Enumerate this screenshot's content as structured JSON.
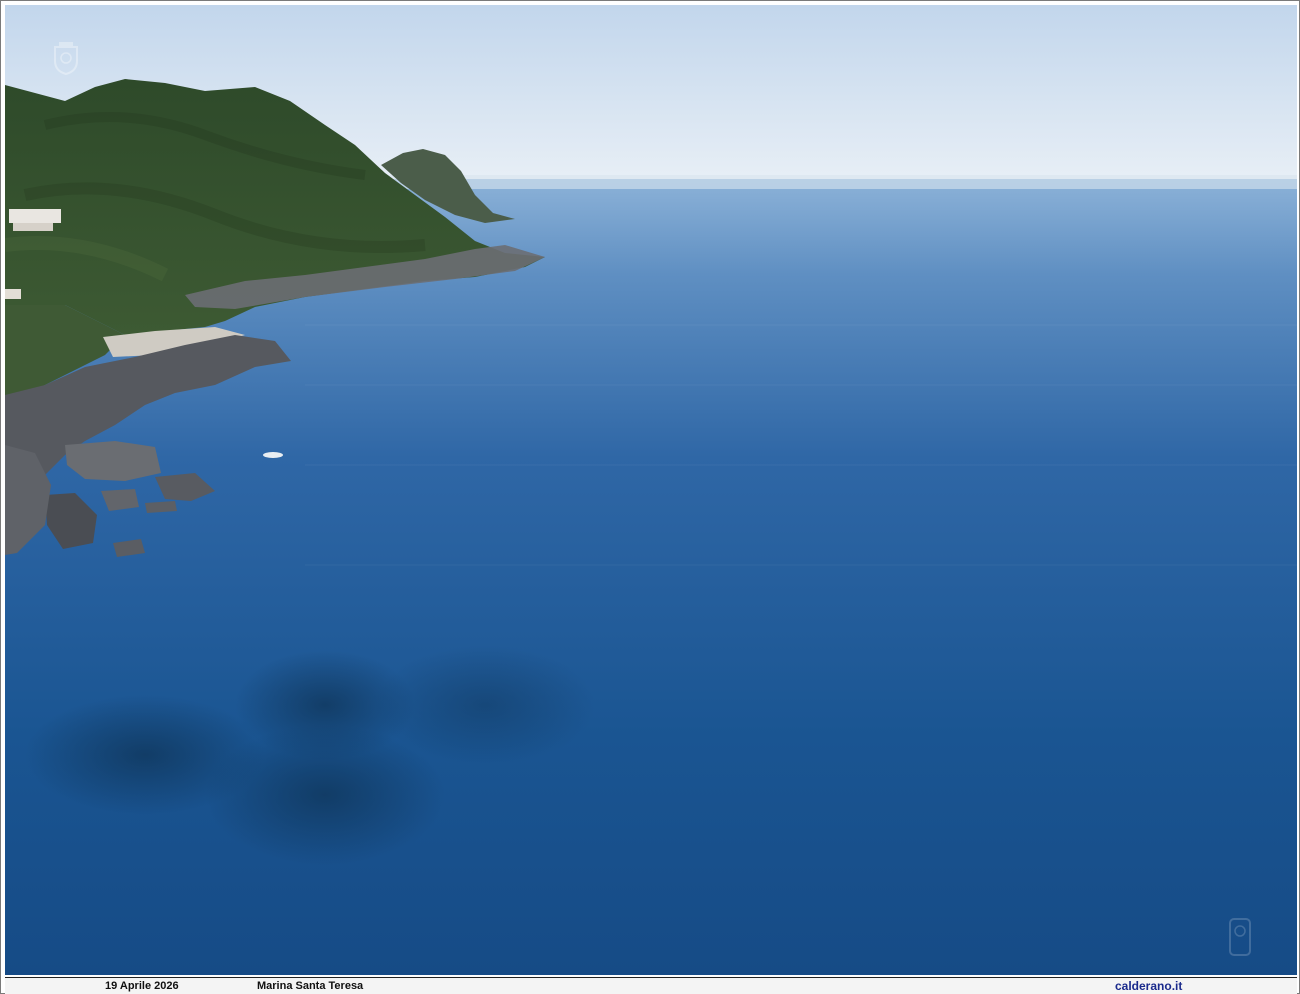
{
  "photo": {
    "description_icon": "coastal-aerial-photo",
    "colors": {
      "sky_top": "#c9dbee",
      "sky_horizon": "#e6eef5",
      "sea_far": "#7fa7cf",
      "sea_mid": "#2f64a1",
      "sea_near": "#134a86",
      "hill_green": "#2f4d2a",
      "rock": "#5e6167"
    }
  },
  "caption": {
    "date": "19 Aprile 2026",
    "location": "Marina Santa Teresa",
    "site": "calderano.it"
  }
}
